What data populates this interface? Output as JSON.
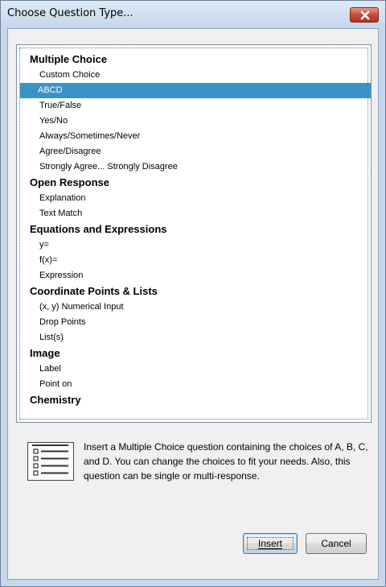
{
  "window": {
    "title": "Choose Question Type...",
    "close_icon": "close-icon"
  },
  "list": {
    "selected": "ABCD",
    "rows": [
      {
        "type": "category",
        "label": "Multiple Choice"
      },
      {
        "type": "item",
        "label": "Custom Choice"
      },
      {
        "type": "item",
        "label": "ABCD",
        "selected": true
      },
      {
        "type": "item",
        "label": "True/False"
      },
      {
        "type": "item",
        "label": "Yes/No"
      },
      {
        "type": "item",
        "label": "Always/Sometimes/Never"
      },
      {
        "type": "item",
        "label": "Agree/Disagree"
      },
      {
        "type": "item",
        "label": "Strongly Agree... Strongly Disagree"
      },
      {
        "type": "category",
        "label": "Open Response"
      },
      {
        "type": "item",
        "label": "Explanation"
      },
      {
        "type": "item",
        "label": "Text Match"
      },
      {
        "type": "category",
        "label": "Equations and Expressions"
      },
      {
        "type": "item",
        "label": "y="
      },
      {
        "type": "item",
        "label": "f(x)="
      },
      {
        "type": "item",
        "label": "Expression"
      },
      {
        "type": "category",
        "label": "Coordinate Points & Lists"
      },
      {
        "type": "item",
        "label": "(x, y) Numerical Input"
      },
      {
        "type": "item",
        "label": "Drop Points"
      },
      {
        "type": "item",
        "label": "List(s)"
      },
      {
        "type": "category",
        "label": "Image"
      },
      {
        "type": "item",
        "label": "Label"
      },
      {
        "type": "item",
        "label": "Point on"
      },
      {
        "type": "category",
        "label": "Chemistry"
      }
    ]
  },
  "description": {
    "icon": "multiple-choice-list-icon",
    "text": "Insert a Multiple Choice question containing the choices of A, B, C, and D.  You can change the choices to fit your needs.  Also, this question can be single or multi-response."
  },
  "buttons": {
    "insert_label": "Insert",
    "cancel_label": "Cancel"
  },
  "colors": {
    "selection": "#3a93c4",
    "frame": "#c6d7ea",
    "close": "#c8493a"
  }
}
